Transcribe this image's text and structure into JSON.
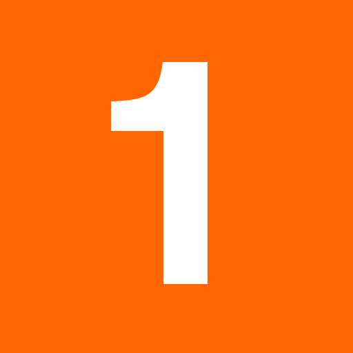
{
  "tile": {
    "digit": "1",
    "background_color": "#FF6600",
    "digit_color": "#FFFFFF"
  }
}
